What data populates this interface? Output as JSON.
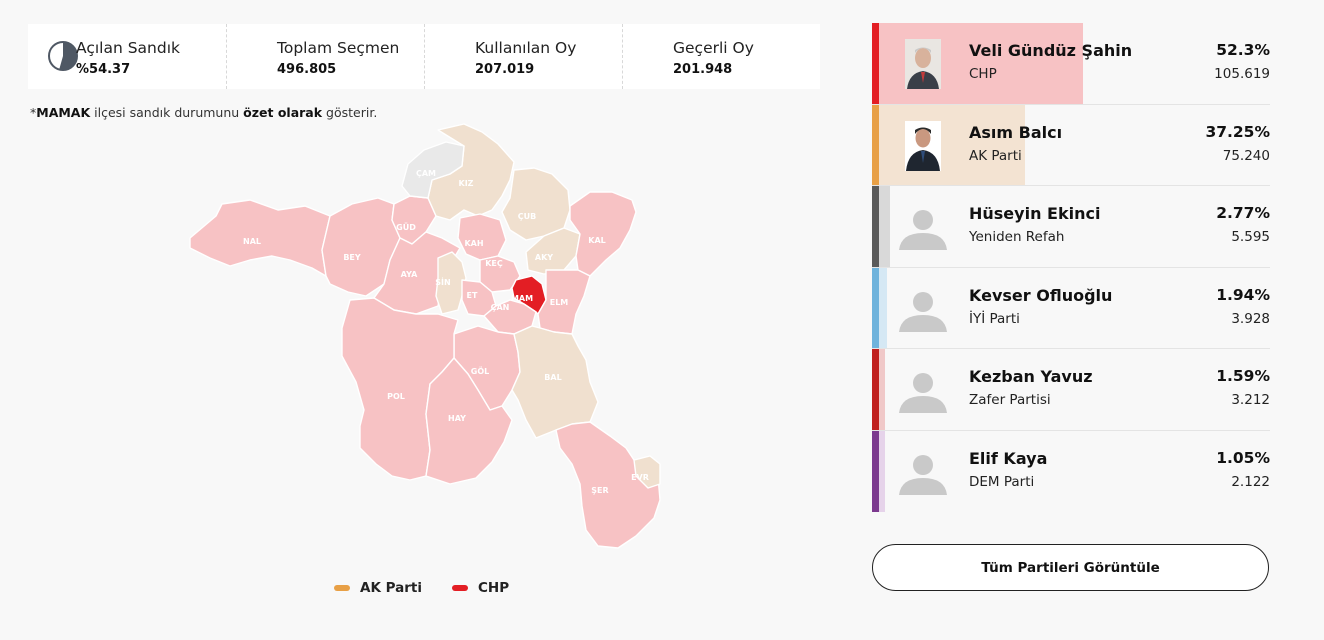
{
  "stats": [
    {
      "label": "Açılan Sandık",
      "value": "%54.37",
      "icon": "pie-chart-icon"
    },
    {
      "label": "Toplam Seçmen",
      "value": "496.805"
    },
    {
      "label": "Kullanılan Oy",
      "value": "207.019"
    },
    {
      "label": "Geçerli Oy",
      "value": "201.948"
    }
  ],
  "opened_fraction": 0.5437,
  "note": {
    "prefix": "*",
    "district": "MAMAK",
    "mid": " ilçesi sandık durumunu ",
    "bold": "özet olarak",
    "suffix": " gösterir."
  },
  "map": {
    "labels": [
      "NAL",
      "BEY",
      "GÜD",
      "AYA",
      "KIZ",
      "ÇAM",
      "ÇUB",
      "KAH",
      "KEÇ",
      "AKY",
      "KAL",
      "SİN",
      "MAM",
      "ELM",
      "ET",
      "ÇAN",
      "GÖL",
      "BAL",
      "POL",
      "HAY",
      "ŞER",
      "EVR"
    ],
    "colors": {
      "chp": "#e31e24",
      "chp_light": "#f7c2c4",
      "akp_light": "#f0e0cf",
      "none": "#e9e9e9"
    }
  },
  "legend": [
    {
      "label": "AK Parti",
      "color": "#e8a046"
    },
    {
      "label": "CHP",
      "color": "#e31e24"
    }
  ],
  "candidates": [
    {
      "name": "Veli Gündüz Şahin",
      "party": "CHP",
      "pct": "52.3%",
      "votes": "105.619",
      "pct_value": 52.3,
      "bar_color": "#e31e24",
      "fill_color": "#f7c2c4",
      "photo": "photo"
    },
    {
      "name": "Asım Balcı",
      "party": "AK Parti",
      "pct": "37.25%",
      "votes": "75.240",
      "pct_value": 37.25,
      "bar_color": "#e8a046",
      "fill_color": "#f3e3d2",
      "photo": "photo"
    },
    {
      "name": "Hüseyin Ekinci",
      "party": "Yeniden Refah",
      "pct": "2.77%",
      "votes": "5.595",
      "pct_value": 2.77,
      "bar_color": "#5a5a5a",
      "fill_color": "#d9d9d9",
      "photo": "placeholder"
    },
    {
      "name": "Kevser Ofluoğlu",
      "party": "İYİ Parti",
      "pct": "1.94%",
      "votes": "3.928",
      "pct_value": 1.94,
      "bar_color": "#6fb3dc",
      "fill_color": "#d5e8f4",
      "photo": "placeholder"
    },
    {
      "name": "Kezban Yavuz",
      "party": "Zafer Partisi",
      "pct": "1.59%",
      "votes": "3.212",
      "pct_value": 1.59,
      "bar_color": "#c0201f",
      "fill_color": "#f0c8c8",
      "photo": "placeholder"
    },
    {
      "name": "Elif Kaya",
      "party": "DEM Parti",
      "pct": "1.05%",
      "votes": "2.122",
      "pct_value": 1.05,
      "bar_color": "#7c3a8f",
      "fill_color": "#e6d3ea",
      "photo": "placeholder"
    }
  ],
  "all_parties_button": "Tüm Partileri Görüntüle"
}
